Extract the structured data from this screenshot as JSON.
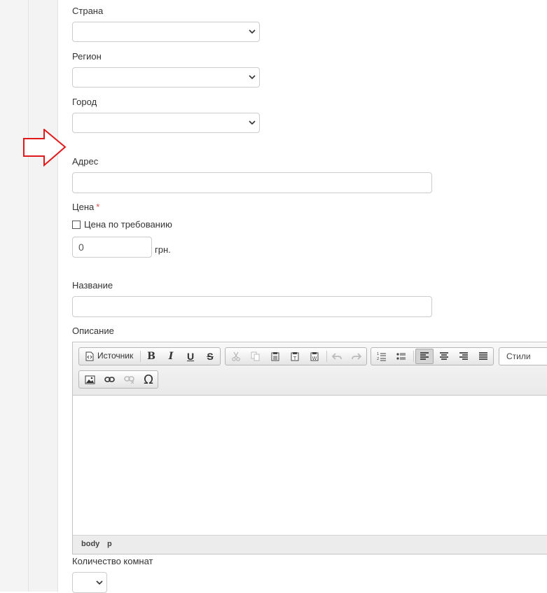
{
  "form": {
    "country_label": "Страна",
    "region_label": "Регион",
    "city_label": "Город",
    "address_label": "Адрес",
    "price_label": "Цена",
    "required_mark": "*",
    "price_on_request_label": "Цена по требованию",
    "price_value": "0",
    "currency": "грн.",
    "title_label": "Название",
    "description_label": "Описание",
    "rooms_label": "Количество комнат"
  },
  "editor": {
    "source_label": "Источник",
    "styles_label": "Стили",
    "path_body": "body",
    "path_p": "p",
    "toolbar_icons": [
      "source-icon",
      "bold-icon",
      "italic-icon",
      "underline-icon",
      "strike-icon",
      "cut-icon",
      "copy-icon",
      "paste-icon",
      "paste-text-icon",
      "paste-word-icon",
      "undo-icon",
      "redo-icon",
      "numbered-list-icon",
      "bulleted-list-icon",
      "align-left-icon",
      "align-center-icon",
      "align-right-icon",
      "justify-icon",
      "image-icon",
      "link-icon",
      "unlink-icon",
      "special-char-icon"
    ]
  },
  "colors": {
    "arrow": "#e0191b",
    "required": "#d9534f"
  }
}
